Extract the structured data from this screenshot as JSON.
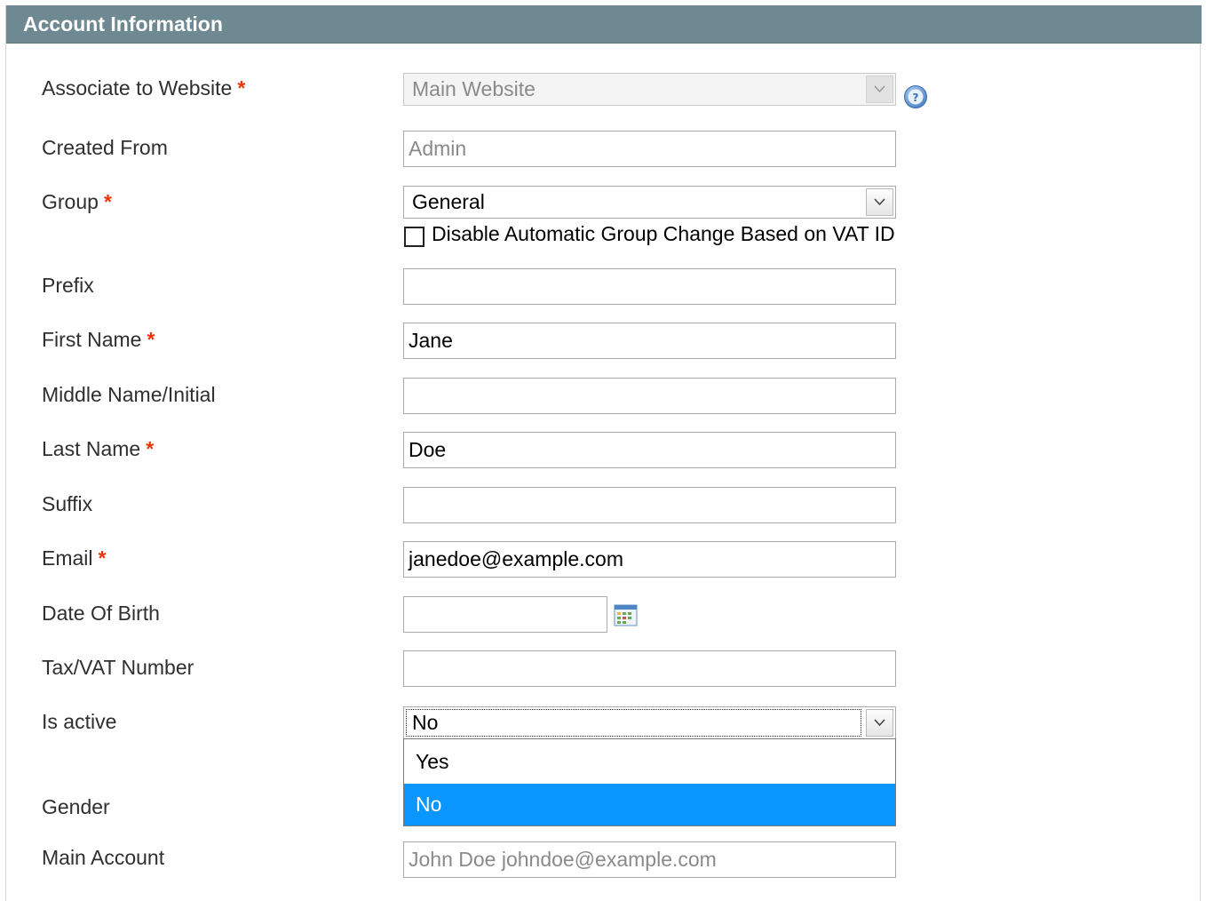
{
  "panel": {
    "title": "Account Information"
  },
  "fields": {
    "website": {
      "label": "Associate to Website",
      "value": "Main Website"
    },
    "created_from": {
      "label": "Created From",
      "value": "Admin"
    },
    "group": {
      "label": "Group",
      "value": "General",
      "checkbox_label": "Disable Automatic Group Change Based on VAT ID"
    },
    "prefix": {
      "label": "Prefix",
      "value": ""
    },
    "first_name": {
      "label": "First Name",
      "value": "Jane"
    },
    "middle_name": {
      "label": "Middle Name/Initial",
      "value": ""
    },
    "last_name": {
      "label": "Last Name",
      "value": "Doe"
    },
    "suffix": {
      "label": "Suffix",
      "value": ""
    },
    "email": {
      "label": "Email",
      "value": "janedoe@example.com"
    },
    "dob": {
      "label": "Date Of Birth",
      "value": ""
    },
    "taxvat": {
      "label": "Tax/VAT Number",
      "value": ""
    },
    "is_active": {
      "label": "Is active",
      "value": "No",
      "options": [
        "Yes",
        "No"
      ]
    },
    "gender": {
      "label": "Gender"
    },
    "main_account": {
      "label": "Main Account",
      "value": "John Doe johndoe@example.com"
    }
  },
  "required_marker": "*",
  "icons": {
    "help": "help-question-icon",
    "calendar": "calendar-icon",
    "dropdown": "chevron-down-icon"
  },
  "colors": {
    "header_bg": "#6f8992",
    "required": "#eb340a",
    "selected_option": "#0a96ff"
  }
}
